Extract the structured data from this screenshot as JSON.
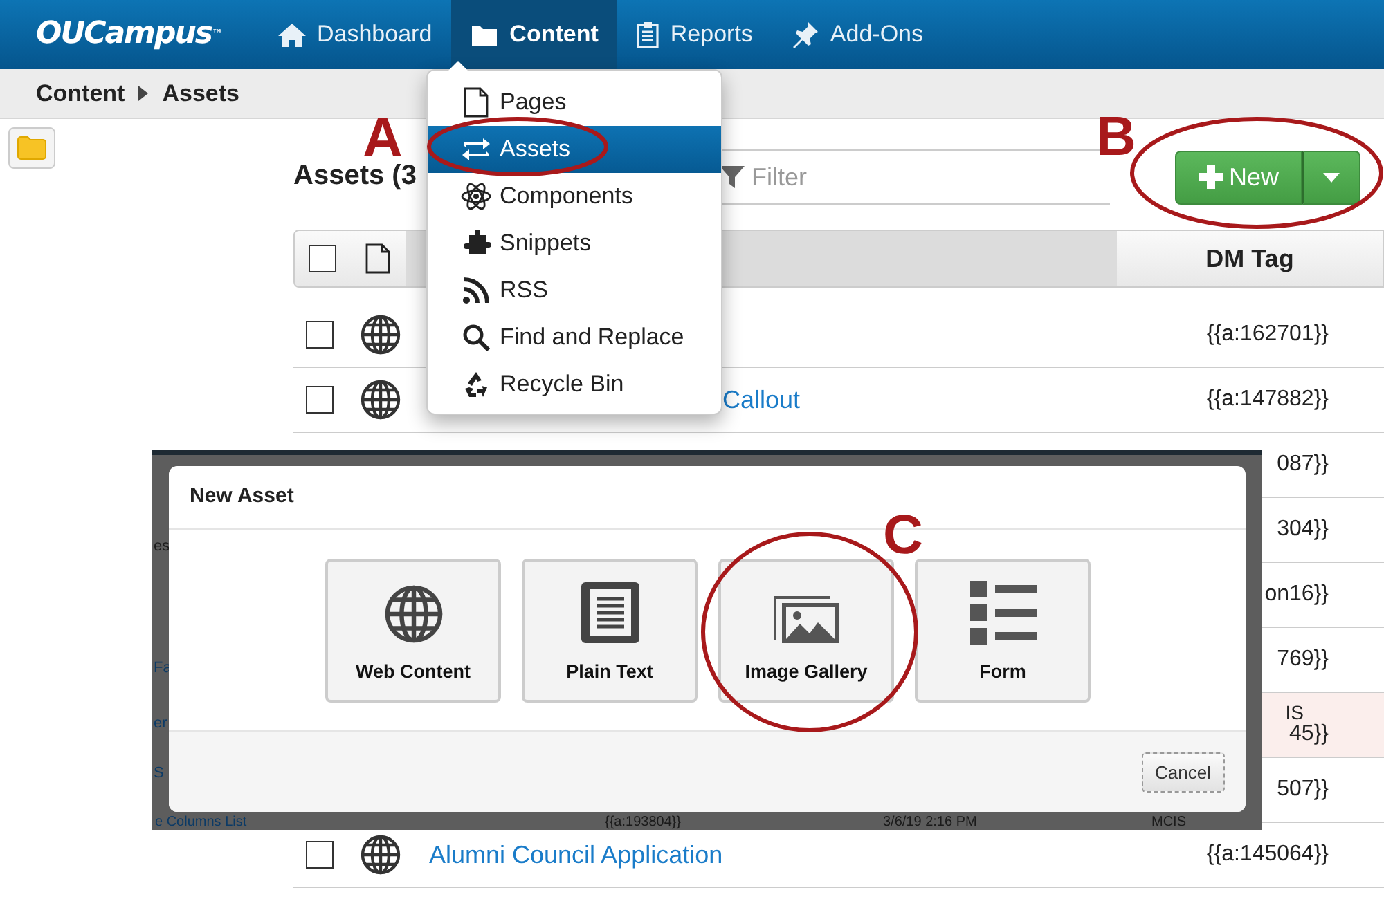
{
  "brand": {
    "name": "OUCampus",
    "mark": "™"
  },
  "nav": [
    {
      "label": "Dashboard",
      "selected": false
    },
    {
      "label": "Content",
      "selected": true
    },
    {
      "label": "Reports",
      "selected": false
    },
    {
      "label": "Add-Ons",
      "selected": false
    }
  ],
  "breadcrumb": [
    "Content",
    "Assets"
  ],
  "content_menu": [
    {
      "label": "Pages",
      "selected": false
    },
    {
      "label": "Assets",
      "selected": true
    },
    {
      "label": "Components",
      "selected": false
    },
    {
      "label": "Snippets",
      "selected": false
    },
    {
      "label": "RSS",
      "selected": false
    },
    {
      "label": "Find and Replace",
      "selected": false
    },
    {
      "label": "Recycle Bin",
      "selected": false
    }
  ],
  "title": "Assets (3",
  "filter": {
    "placeholder": "Filter"
  },
  "new_button": {
    "label": "New"
  },
  "table": {
    "select_all": {
      "checked": false
    },
    "columns": [
      "DM Tag"
    ],
    "rows": [
      {
        "kind": "under_menu",
        "checked": false,
        "tag": "{{a:162701}}"
      },
      {
        "kind": "under_menu",
        "checked": false,
        "name": "Callout",
        "tag": "{{a:147882}}"
      },
      {
        "kind": "under_inset",
        "tag": "087}}"
      },
      {
        "kind": "under_inset",
        "tag": "304}}"
      },
      {
        "kind": "under_inset",
        "tag": "on16}}"
      },
      {
        "kind": "under_inset",
        "tag": "769}}"
      },
      {
        "kind": "under_inset",
        "tag": "45}}",
        "column_4": "IS",
        "highlighted": true
      },
      {
        "kind": "under_inset",
        "tag": "507}}"
      },
      {
        "kind": "full",
        "checked": false,
        "name": "Alumni Council Application",
        "tag": "{{a:145064}}"
      }
    ]
  },
  "inset": {
    "backdrop_fragments": [
      {
        "text": "es",
        "kind": "plain"
      },
      {
        "text": "Fa",
        "kind": "link"
      },
      {
        "text": "er",
        "kind": "link"
      },
      {
        "text": "S",
        "kind": "link"
      }
    ],
    "backdrop_row": {
      "name": "e Columns List",
      "tag": "{{a:193804}}",
      "modified": "3/6/19 2:16 PM",
      "owner": "MCIS"
    },
    "modal": {
      "title": "New Asset",
      "tiles": [
        {
          "label": "Web Content"
        },
        {
          "label": "Plain Text"
        },
        {
          "label": "Image Gallery"
        },
        {
          "label": "Form"
        }
      ],
      "cancel": "Cancel"
    }
  },
  "annotations": [
    {
      "label": "A"
    },
    {
      "label": "B"
    },
    {
      "label": "C"
    }
  ]
}
